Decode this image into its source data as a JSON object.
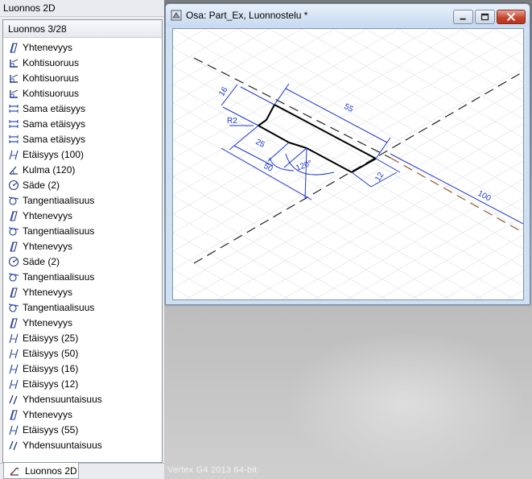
{
  "left_panel": {
    "title": "Luonnos 2D",
    "header": "Luonnos 3/28",
    "items": [
      {
        "label": "Yhtenevyys",
        "icon": "coincident-icon"
      },
      {
        "label": "Kohtisuoruus",
        "icon": "perpendicular-icon"
      },
      {
        "label": "Kohtisuoruus",
        "icon": "perpendicular-icon"
      },
      {
        "label": "Kohtisuoruus",
        "icon": "perpendicular-icon"
      },
      {
        "label": "Sama etäisyys",
        "icon": "equal-distance-icon"
      },
      {
        "label": "Sama etäisyys",
        "icon": "equal-distance-icon"
      },
      {
        "label": "Sama etäisyys",
        "icon": "equal-distance-icon"
      },
      {
        "label": "Etäisyys (100)",
        "icon": "distance-icon"
      },
      {
        "label": "Kulma (120)",
        "icon": "angle-icon"
      },
      {
        "label": "Säde (2)",
        "icon": "radius-icon"
      },
      {
        "label": "Tangentiaalisuus",
        "icon": "tangent-icon"
      },
      {
        "label": "Yhtenevyys",
        "icon": "coincident-icon"
      },
      {
        "label": "Tangentiaalisuus",
        "icon": "tangent-icon"
      },
      {
        "label": "Yhtenevyys",
        "icon": "coincident-icon"
      },
      {
        "label": "Säde (2)",
        "icon": "radius-icon"
      },
      {
        "label": "Tangentiaalisuus",
        "icon": "tangent-icon"
      },
      {
        "label": "Yhtenevyys",
        "icon": "coincident-icon"
      },
      {
        "label": "Tangentiaalisuus",
        "icon": "tangent-icon"
      },
      {
        "label": "Yhtenevyys",
        "icon": "coincident-icon"
      },
      {
        "label": "Etäisyys (25)",
        "icon": "distance-icon"
      },
      {
        "label": "Etäisyys (50)",
        "icon": "distance-icon"
      },
      {
        "label": "Etäisyys (16)",
        "icon": "distance-icon"
      },
      {
        "label": "Etäisyys (12)",
        "icon": "distance-icon"
      },
      {
        "label": "Yhdensuuntaisuus",
        "icon": "parallel-icon"
      },
      {
        "label": "Yhtenevyys",
        "icon": "coincident-icon"
      },
      {
        "label": "Etäisyys (55)",
        "icon": "distance-icon"
      },
      {
        "label": "Yhdensuuntaisuus",
        "icon": "parallel-icon"
      }
    ],
    "tab": {
      "label": "Luonnos 2D",
      "icon": "sketch-2d-icon"
    }
  },
  "document_window": {
    "title": "Osa: Part_Ex, Luonnostelu *",
    "icon": "part-document-icon",
    "controls": [
      "minimize-icon",
      "maximize-icon",
      "close-icon"
    ]
  },
  "sketch": {
    "dimensions": {
      "d16": "16",
      "d55": "55",
      "r2": "R2",
      "d25": "25",
      "d50": "50",
      "a120": "120°",
      "d12": "12",
      "d100": "100"
    }
  },
  "workspace": {
    "version": "Vertex G4  2013  64-bit"
  },
  "colors": {
    "dimension": "#1c36c8",
    "geometry": "#000000",
    "construction": "#8b5a2b",
    "titlebar": "#c6d9ef"
  }
}
